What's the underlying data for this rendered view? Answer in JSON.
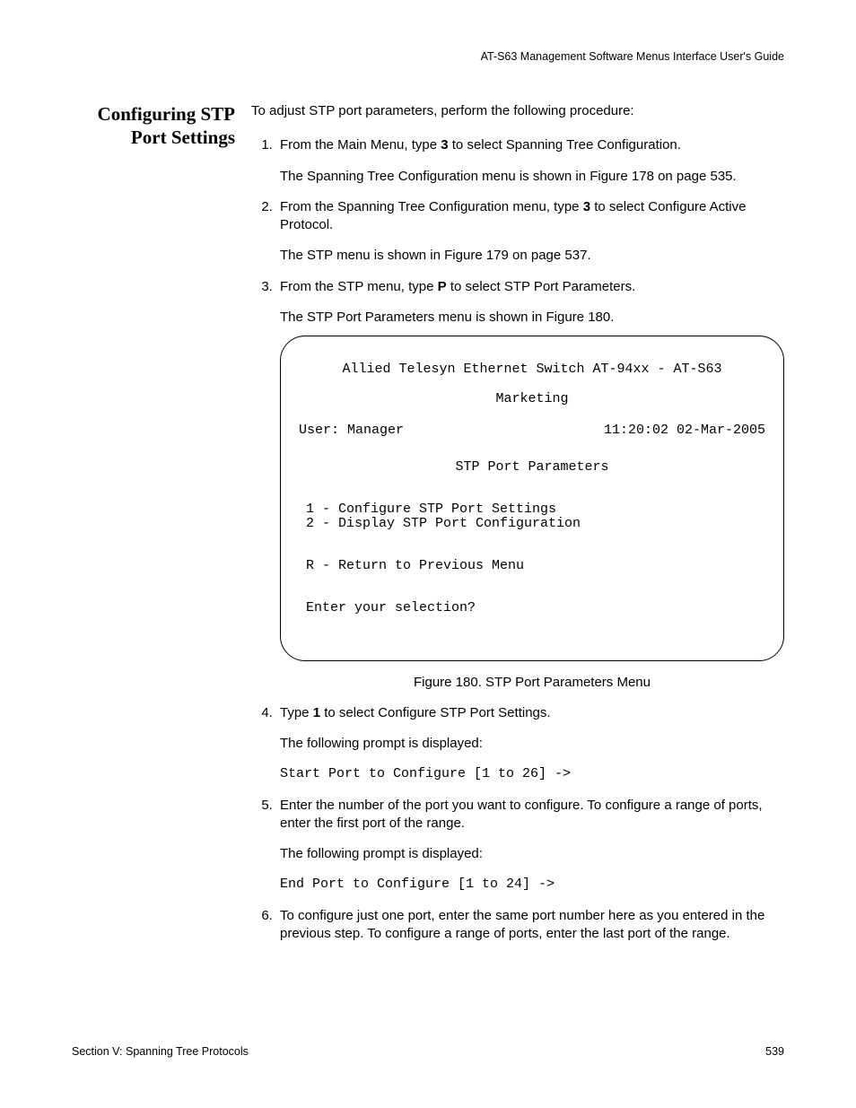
{
  "running_head": "AT-S63 Management Software Menus Interface User's Guide",
  "sidehead": "Configuring STP Port Settings",
  "intro": "To adjust STP port parameters, perform the following procedure:",
  "steps": {
    "s1_a": "From the Main Menu, type ",
    "s1_key": "3",
    "s1_b": " to select Spanning Tree Configuration.",
    "s1_after": "The Spanning Tree Configuration menu is shown in Figure 178 on page 535.",
    "s2_a": "From the Spanning Tree Configuration menu, type ",
    "s2_key": "3",
    "s2_b": " to select Configure Active Protocol.",
    "s2_after": "The STP menu is shown in Figure 179 on page 537.",
    "s3_a": "From the STP menu, type ",
    "s3_key": "P",
    "s3_b": " to select STP Port Parameters.",
    "s3_after": "The STP Port Parameters menu is shown in Figure 180.",
    "s4_a": "Type ",
    "s4_key": "1",
    "s4_b": " to select Configure STP Port Settings.",
    "s4_after": "The following prompt is displayed:",
    "s4_prompt": "Start Port to Configure [1 to 26] ->",
    "s5": "Enter the number of the port you want to configure. To configure a range of ports, enter the first port of the range.",
    "s5_after": "The following prompt is displayed:",
    "s5_prompt": "End Port to Configure [1 to 24] ->",
    "s6": "To configure just one port, enter the same port number here as you entered in the previous step. To configure a range of ports, enter the last port of the range."
  },
  "menu": {
    "title1": "Allied Telesyn Ethernet Switch AT-94xx - AT-S63",
    "title2": "Marketing",
    "user": "User: Manager",
    "timestamp": "11:20:02 02-Mar-2005",
    "heading": "STP Port Parameters",
    "item1": "1 - Configure STP Port Settings",
    "item2": "2 - Display STP Port Configuration",
    "return": "R - Return to Previous Menu",
    "enter": "Enter your selection?"
  },
  "figcap": "Figure 180. STP Port Parameters Menu",
  "footer_left": "Section V: Spanning Tree Protocols",
  "footer_right": "539"
}
